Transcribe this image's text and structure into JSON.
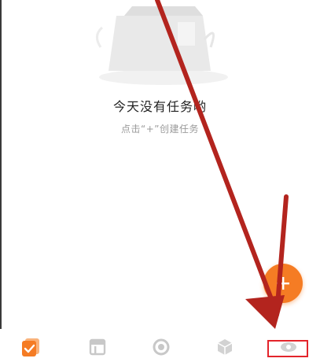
{
  "empty_state": {
    "title": "今天没有任务哟",
    "hint": "点击“+”创建任务"
  },
  "fab": {
    "icon": "plus-icon",
    "color": "#f57c24"
  },
  "tabbar": {
    "items": [
      {
        "icon": "tasks-check-icon",
        "active": true
      },
      {
        "icon": "calendar-icon",
        "active": false
      },
      {
        "icon": "focus-circle-icon",
        "active": false
      },
      {
        "icon": "habit-hexagon-icon",
        "active": false
      },
      {
        "icon": "profile-eye-icon",
        "active": false
      }
    ]
  },
  "annotation": {
    "arrow_color": "#b3241e",
    "box_color": "#e3242b"
  },
  "colors": {
    "accent": "#f57c24",
    "text_primary": "#222222",
    "text_hint": "#9a9a9a",
    "inactive_icon": "#c8c8c8"
  }
}
